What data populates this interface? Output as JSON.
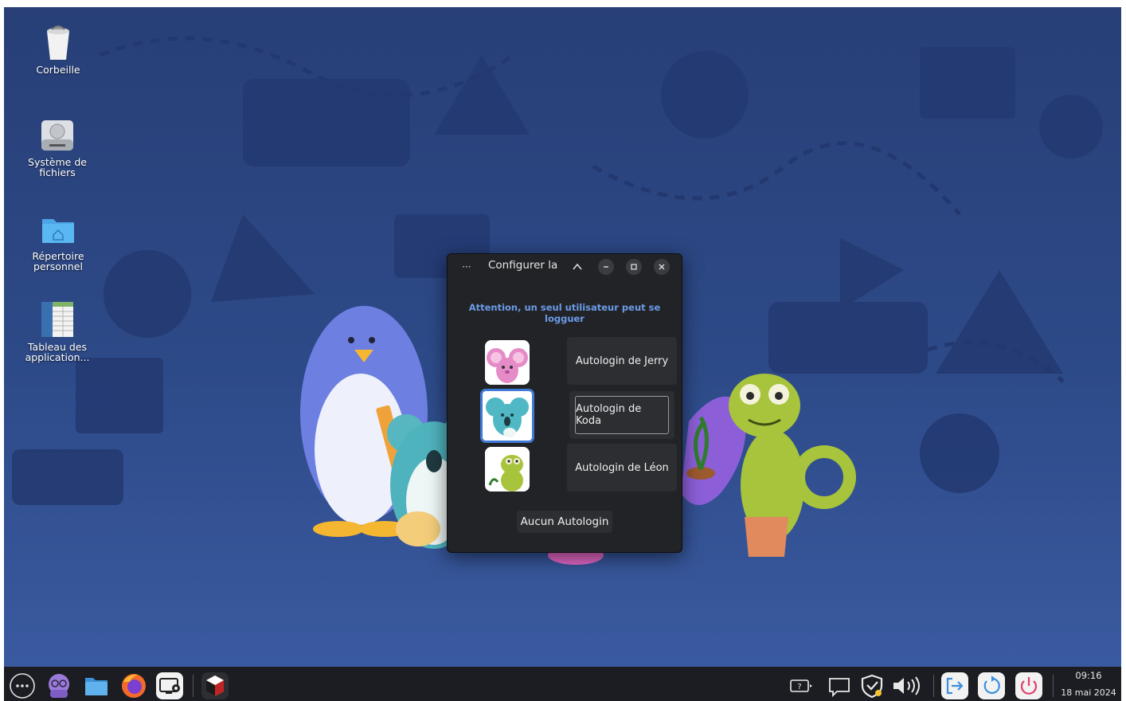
{
  "desktop": {
    "icons": [
      {
        "label": "Corbeille",
        "icon": "trash-icon"
      },
      {
        "label": "Système de\nfichiers",
        "icon": "hard-drive-icon"
      },
      {
        "label": "Répertoire\npersonnel",
        "icon": "home-folder-icon"
      },
      {
        "label": "Tableau des\napplication...",
        "icon": "spreadsheet-icon"
      }
    ]
  },
  "dialog": {
    "title": "Configurer la",
    "menu_label": "···",
    "warning": "Attention, un seul utilisateur peut se logguer",
    "users": [
      {
        "name": "Jerry",
        "button": "Autologin de Jerry",
        "avatar": "mouse-avatar",
        "color": "#e58bc8",
        "selected": false
      },
      {
        "name": "Koda",
        "button": "Autologin de Koda",
        "avatar": "koala-avatar",
        "color": "#4fb8c4",
        "selected": true
      },
      {
        "name": "Léon",
        "button": "Autologin de Léon",
        "avatar": "chameleon-avatar",
        "color": "#a7c43c",
        "selected": false
      }
    ],
    "none_button": "Aucun Autologin"
  },
  "taskbar": {
    "launchers": [
      "menu-icon",
      "octopus-icon",
      "files-icon",
      "firefox-icon",
      "settings-icon",
      "active-app-icon"
    ],
    "tray": [
      "help-icon",
      "notification-icon",
      "shield-icon",
      "volume-icon"
    ],
    "session": [
      "logout-icon",
      "restart-icon",
      "power-icon"
    ],
    "time": "09:16",
    "date": "18 mai 2024"
  },
  "colors": {
    "accent": "#6b9be8",
    "selection": "#3f7bd6",
    "desktop_bg": "#2b4585",
    "taskbar_bg": "#1c1d22"
  }
}
